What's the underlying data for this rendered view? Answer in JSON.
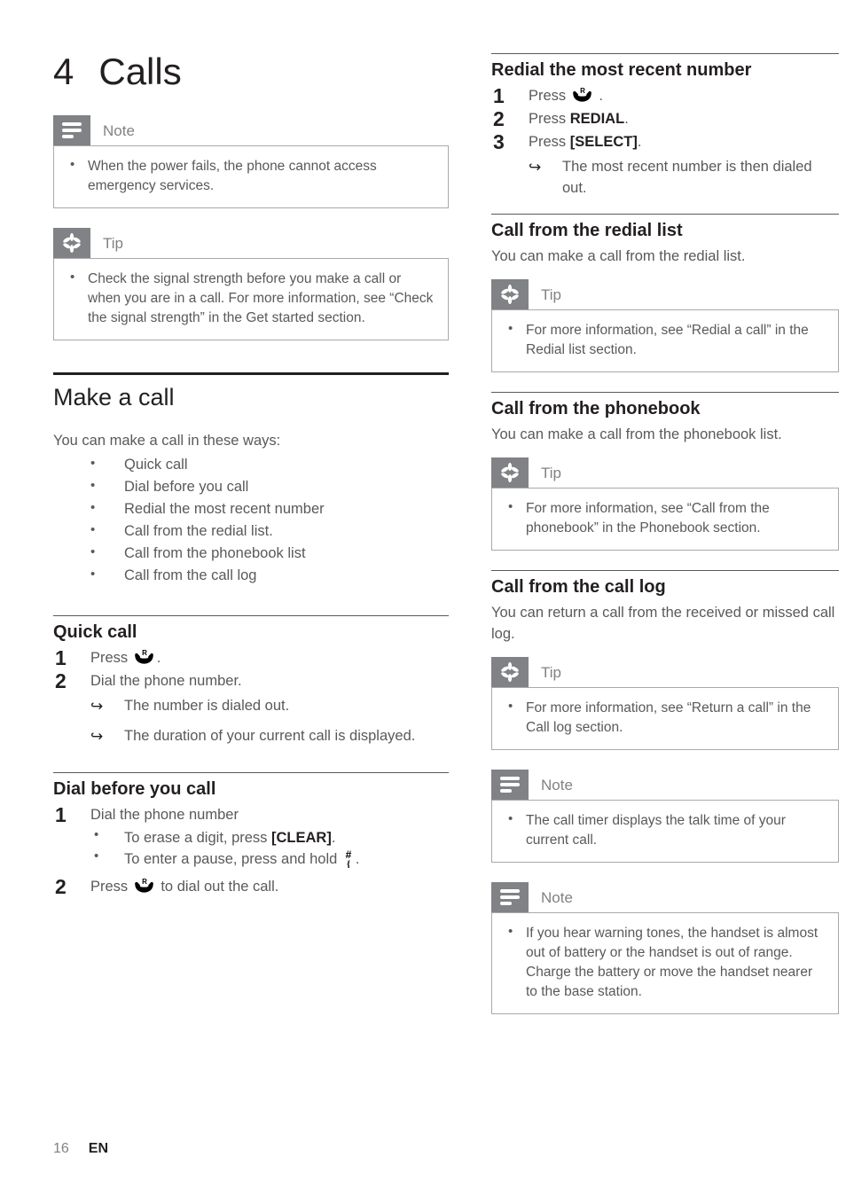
{
  "chapter": {
    "number": "4",
    "title": "Calls"
  },
  "footer": {
    "page_number": "16",
    "language": "EN"
  },
  "colors": {
    "badge_gray": "#808285",
    "body_text": "#58595b",
    "heading_text": "#231f20",
    "box_border": "#a7a9ac"
  },
  "left_column": {
    "note_top": {
      "label": "Note",
      "icon": "note-lines-icon",
      "items": [
        "When the power fails, the phone cannot access emergency services."
      ]
    },
    "tip_top": {
      "label": "Tip",
      "icon": "tip-asterisk-icon",
      "items": [
        "Check the signal strength before you make a call or when you are in a call. For more information, see “Check the signal strength” in the Get started section."
      ]
    },
    "make_a_call": {
      "heading": "Make a call",
      "intro": "You can make a call in these ways:",
      "ways": [
        "Quick call",
        "Dial before you call",
        "Redial the most recent number",
        "Call from the redial list.",
        "Call from the phonebook list",
        "Call from the call log"
      ]
    },
    "quick_call": {
      "heading": "Quick call",
      "steps": [
        {
          "num": "1",
          "before": "Press ",
          "icon": "handset-call-icon",
          "after": "."
        },
        {
          "num": "2",
          "before": "Dial the phone number.",
          "icon": "",
          "after": "",
          "results": [
            "The number is dialed out.",
            "The duration of your current call is displayed."
          ]
        }
      ]
    },
    "dial_before_you_call": {
      "heading": "Dial before you call",
      "step1": {
        "num": "1",
        "text": "Dial the phone number",
        "substeps": [
          {
            "before": "To erase a digit, press ",
            "kbd": "[CLEAR]",
            "after": ".",
            "icon": ""
          },
          {
            "before": "To enter a pause, press and hold ",
            "kbd": "",
            "after": ".",
            "icon": "hash-pause-icon"
          }
        ]
      },
      "step2": {
        "num": "2",
        "before": "Press ",
        "icon": "handset-call-icon",
        "after": " to dial out the call."
      }
    }
  },
  "right_column": {
    "redial_recent": {
      "heading": "Redial the most recent number",
      "steps": [
        {
          "num": "1",
          "before": "Press ",
          "icon": "handset-call-icon",
          "after": " ."
        },
        {
          "num": "2",
          "before": "Press ",
          "kbd": "REDIAL",
          "after": "."
        },
        {
          "num": "3",
          "before": "Press ",
          "kbd": "[SELECT]",
          "after": ".",
          "results": [
            "The most recent number is then dialed out."
          ]
        }
      ]
    },
    "call_redial_list": {
      "heading": "Call from the redial list",
      "intro": "You can make a call from the redial list.",
      "tip": {
        "label": "Tip",
        "icon": "tip-asterisk-icon",
        "items": [
          "For more information, see “Redial a call” in the Redial list section."
        ]
      }
    },
    "call_phonebook": {
      "heading": "Call from the phonebook",
      "intro": "You can make a call from the phonebook list.",
      "tip": {
        "label": "Tip",
        "icon": "tip-asterisk-icon",
        "items": [
          "For more information, see “Call from the phonebook” in the Phonebook section."
        ]
      }
    },
    "call_log": {
      "heading": "Call from the call log",
      "intro": "You can return a call from the received or missed call log.",
      "tip": {
        "label": "Tip",
        "icon": "tip-asterisk-icon",
        "items": [
          "For more information, see “Return a call” in the Call log section."
        ]
      },
      "note_timer": {
        "label": "Note",
        "icon": "note-lines-icon",
        "items": [
          "The call timer displays the talk time of your current call."
        ]
      },
      "note_warning": {
        "label": "Note",
        "icon": "note-lines-icon",
        "items": [
          "If you hear warning tones, the handset is almost out of battery or the handset is out of range. Charge the battery or move the handset nearer to the base station."
        ]
      }
    }
  }
}
